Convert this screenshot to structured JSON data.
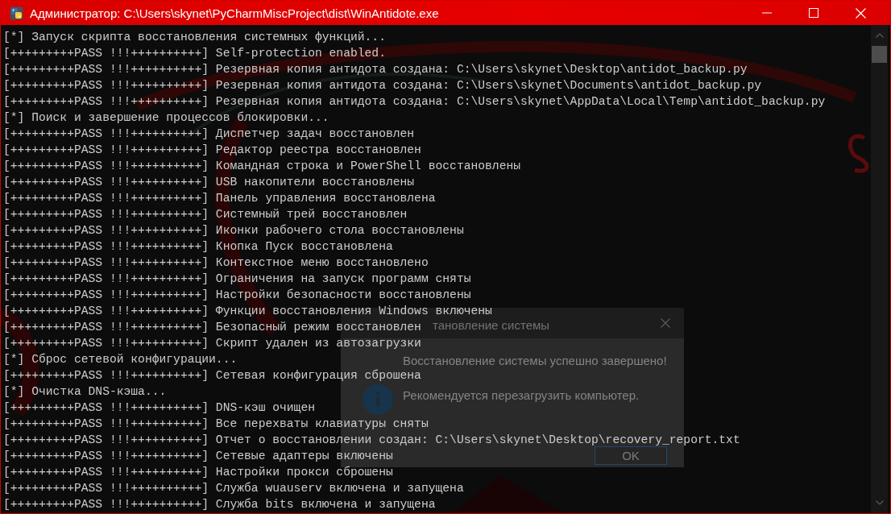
{
  "window": {
    "title": "Администратор: C:\\Users\\skynet\\PyCharmMiscProject\\dist\\WinAntidote.exe"
  },
  "console": {
    "lines": [
      "[*] Запуск скрипта восстановления системных функций...",
      "[+++++++++PASS !!!++++++++++] Self-protection enabled.",
      "[+++++++++PASS !!!++++++++++] Резервная копия антидота создана: C:\\Users\\skynet\\Desktop\\antidot_backup.py",
      "[+++++++++PASS !!!++++++++++] Резервная копия антидота создана: C:\\Users\\skynet\\Documents\\antidot_backup.py",
      "[+++++++++PASS !!!++++++++++] Резервная копия антидота создана: C:\\Users\\skynet\\AppData\\Local\\Temp\\antidot_backup.py",
      "[*] Поиск и завершение процессов блокировки...",
      "[+++++++++PASS !!!++++++++++] Диспетчер задач восстановлен",
      "[+++++++++PASS !!!++++++++++] Редактор реестра восстановлен",
      "[+++++++++PASS !!!++++++++++] Командная строка и PowerShell восстановлены",
      "[+++++++++PASS !!!++++++++++] USB накопители восстановлены",
      "[+++++++++PASS !!!++++++++++] Панель управления восстановлена",
      "[+++++++++PASS !!!++++++++++] Системный трей восстановлен",
      "[+++++++++PASS !!!++++++++++] Иконки рабочего стола восстановлены",
      "[+++++++++PASS !!!++++++++++] Кнопка Пуск восстановлена",
      "[+++++++++PASS !!!++++++++++] Контекстное меню восстановлено",
      "[+++++++++PASS !!!++++++++++] Ограничения на запуск программ сняты",
      "[+++++++++PASS !!!++++++++++] Настройки безопасности восстановлены",
      "[+++++++++PASS !!!++++++++++] Функции восстановления Windows включены",
      "[+++++++++PASS !!!++++++++++] Безопасный режим восстановлен",
      "[+++++++++PASS !!!++++++++++] Скрипт удален из автозагрузки",
      "[*] Сброс сетевой конфигурации...",
      "[+++++++++PASS !!!++++++++++] Сетевая конфигурация сброшена",
      "[*] Очистка DNS-кэша...",
      "[+++++++++PASS !!!++++++++++] DNS-кэш очищен",
      "[+++++++++PASS !!!++++++++++] Все перехваты клавиатуры сняты",
      "[+++++++++PASS !!!++++++++++] Отчет о восстановлении создан: C:\\Users\\skynet\\Desktop\\recovery_report.txt",
      "[+++++++++PASS !!!++++++++++] Сетевые адаптеры включены",
      "[+++++++++PASS !!!++++++++++] Настройки прокси сброшены",
      "[+++++++++PASS !!!++++++++++] Служба wuauserv включена и запущена",
      "[+++++++++PASS !!!++++++++++] Служба bits включена и запущена"
    ]
  },
  "dialog": {
    "title": "тановление системы",
    "messages": [
      "Восстановление системы успешно завершено!",
      "Рекомендуется перезагрузить компьютер."
    ],
    "button": "OK"
  }
}
